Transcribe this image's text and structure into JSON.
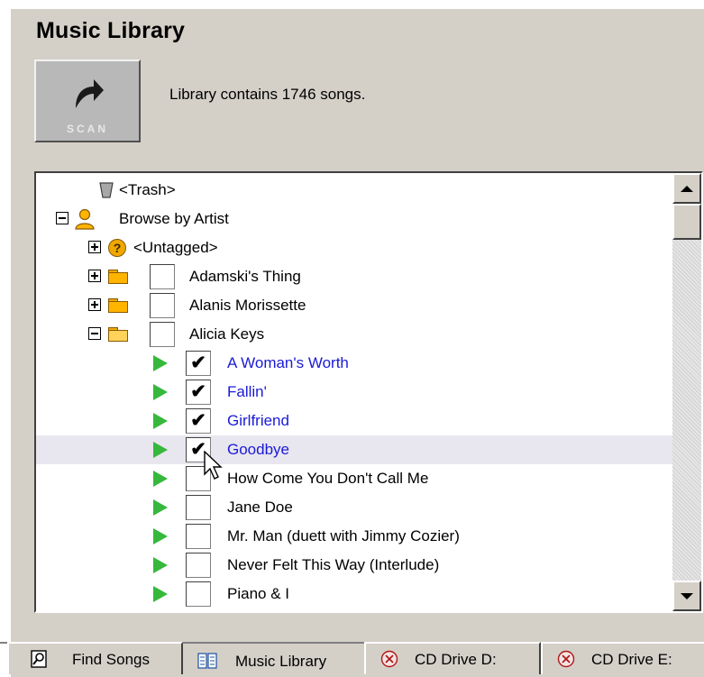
{
  "header": {
    "title": "Music Library",
    "scan_label": "SCAN",
    "status": "Library contains 1746 songs."
  },
  "tree": {
    "rows": [
      {
        "label": "<Trash>"
      },
      {
        "label": "Browse by Artist"
      },
      {
        "label": "<Untagged>"
      },
      {
        "label": "Adamski's Thing"
      },
      {
        "label": "Alanis Morissette"
      },
      {
        "label": "Alicia Keys"
      },
      {
        "label": "A Woman's Worth",
        "check": "✔"
      },
      {
        "label": "Fallin'",
        "check": "✔"
      },
      {
        "label": "Girlfriend",
        "check": "✔"
      },
      {
        "label": "Goodbye",
        "check": "✔"
      },
      {
        "label": "How Come You Don't Call Me",
        "check": ""
      },
      {
        "label": "Jane Doe",
        "check": ""
      },
      {
        "label": "Mr. Man (duett with Jimmy Cozier)",
        "check": ""
      },
      {
        "label": "Never Felt This Way (Interlude)",
        "check": ""
      },
      {
        "label": "Piano & I",
        "check": ""
      }
    ]
  },
  "tabs": [
    {
      "label": "Find Songs"
    },
    {
      "label": "Music Library"
    },
    {
      "label": "CD Drive D:"
    },
    {
      "label": "CD Drive E:"
    }
  ],
  "colors": {
    "window_bg": "#d4d0c8",
    "checked_song_text": "#1a1ad8",
    "play_icon": "#36b83c",
    "folder_icon": "#ffb400"
  }
}
